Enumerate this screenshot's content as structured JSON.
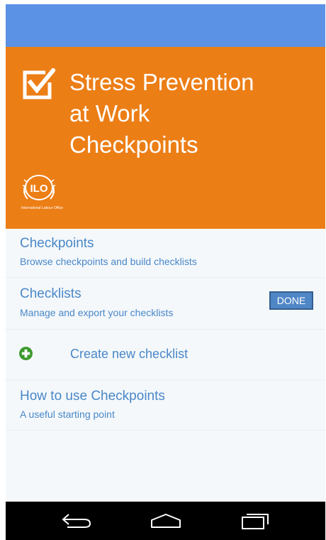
{
  "app": {
    "title": "Stress Prevention\nat Work\nCheckpoints",
    "logo_caption": "International Labour Office",
    "logo_mark": "ILO"
  },
  "menu": {
    "checkpoints": {
      "title": "Checkpoints",
      "subtitle": "Browse checkpoints and build checklists"
    },
    "checklists": {
      "title": "Checklists",
      "subtitle": "Manage and export your checklists",
      "done_label": "DONE"
    },
    "create": {
      "label": "Create new checklist",
      "icon": "plus-circle-icon"
    },
    "howto": {
      "title": "How to use Checkpoints",
      "subtitle": "A useful starting point"
    }
  },
  "nav": {
    "back_icon": "back-icon",
    "home_icon": "home-icon",
    "recents_icon": "recents-icon"
  },
  "colors": {
    "status_bar": "#5b92e5",
    "hero": "#ec7e16",
    "link": "#4a87c7",
    "done_button": "#4f86c6",
    "plus_icon": "#3d9a2f"
  }
}
